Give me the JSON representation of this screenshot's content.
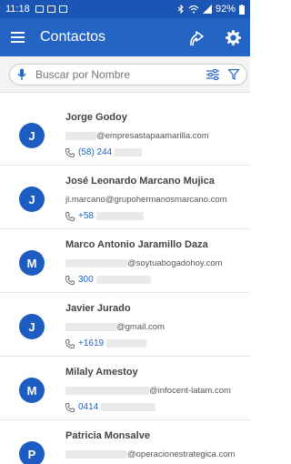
{
  "status": {
    "time": "11:18",
    "battery": "92%"
  },
  "header": {
    "title": "Contactos"
  },
  "search": {
    "placeholder": "Buscar por Nombre"
  },
  "contacts": [
    {
      "initial": "J",
      "name": "Jorge Godoy",
      "email": "@empresastapaamarilla.com",
      "phone": "(58) 244"
    },
    {
      "initial": "J",
      "name": "José Leonardo Marcano Mujica",
      "email": "jl.marcano@grupohermanosmarcano.com",
      "phone": "+58"
    },
    {
      "initial": "M",
      "name": "Marco Antonio Jaramillo Daza",
      "email": "@soytuabogadohoy.com",
      "phone": "300"
    },
    {
      "initial": "J",
      "name": "Javier Jurado",
      "email": "@gmail.com",
      "phone": "+1619"
    },
    {
      "initial": "M",
      "name": "Milaly Amestoy",
      "email": "@infocent-latam.com",
      "phone": "0414"
    },
    {
      "initial": "P",
      "name": "Patricia Monsalve",
      "email": "@operacionestrategica.com",
      "phone": ""
    }
  ]
}
